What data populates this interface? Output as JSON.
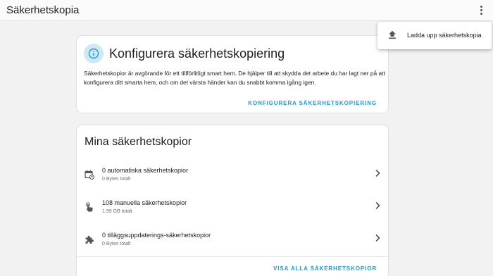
{
  "header": {
    "title": "Säkerhetskopia",
    "menu_icon": "more-vertical-icon"
  },
  "overflow_menu": {
    "items": [
      {
        "label": "Ladda upp säkerhetskopia",
        "icon": "upload-icon"
      }
    ]
  },
  "configure_card": {
    "icon": "info-icon",
    "heading": "Konfigurera säkerhetskopiering",
    "description": "Säkerhetskopior är avgörande för ett tillförlitligt smart hem. De hjälper till att skydda det arbete du har lagt ner på att konfigurera ditt smarta hem, och om det värsta händer kan du snabbt komma igång igen.",
    "action_label": "KONFIGURERA SÄKERHETSKOPIERING"
  },
  "backups_card": {
    "heading": "Mina säkerhetskopior",
    "rows": [
      {
        "icon": "calendar-sync-icon",
        "primary": "0 automatiska säkerhetskopior",
        "secondary": "0 Bytes totalt"
      },
      {
        "icon": "gesture-tap-icon",
        "primary": "108 manuella säkerhetskopior",
        "secondary": "1.99 GB totalt"
      },
      {
        "icon": "puzzle-icon",
        "primary": "0 tilläggsuppdaterings-säkerhetskopior",
        "secondary": "0 Bytes totalt"
      }
    ],
    "action_label": "VISA ALLA SÄKERHETSKOPIOR"
  },
  "colors": {
    "accent": "#1e9bd7",
    "info_icon_bg": "#cfe8f6",
    "background": "#f2f2f2"
  }
}
